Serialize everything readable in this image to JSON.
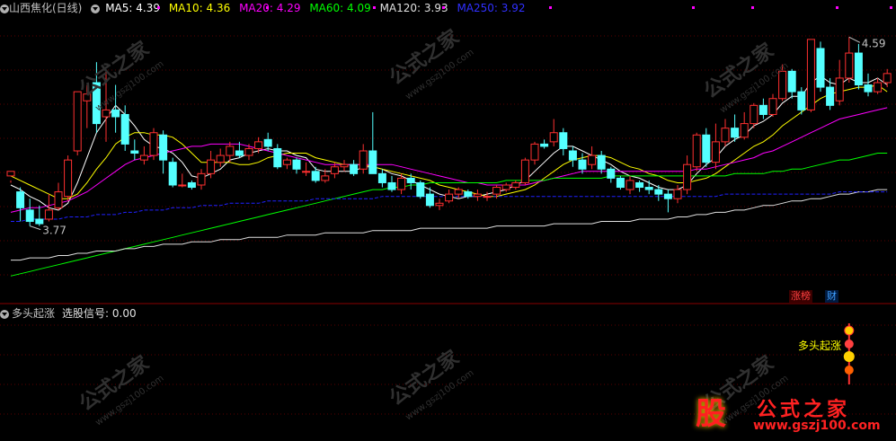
{
  "main_header": {
    "stock_name": "山西焦化(日线)",
    "ma5": "MA5: 4.39",
    "ma10": "MA10: 4.36",
    "ma20": "MA20: 4.29",
    "ma60": "MA60: 4.09",
    "ma120": "MA120: 3.93",
    "ma250": "MA250: 3.92"
  },
  "colors": {
    "ma5": "#ffffff",
    "ma10": "#ffff00",
    "ma20": "#ff00ff",
    "ma60": "#00ff00",
    "ma120": "#e0e0e0",
    "ma250": "#2020ff",
    "up": "#ff3030",
    "down": "#54ffff"
  },
  "price_labels": {
    "high": "4.59",
    "low": "3.77"
  },
  "tags": {
    "limit_up_list": "涨榜",
    "finance": "财"
  },
  "indicator_header": {
    "name": "多头起涨",
    "signal": "选股信号: 0.00"
  },
  "signal_label": "多头起涨",
  "logo": {
    "mark": "股",
    "brand": "公式之家",
    "url": "www.gszj100.com"
  },
  "watermark": {
    "brand": "公式之家",
    "url": "www.gszj100.com"
  },
  "chart_data": {
    "type": "candlestick",
    "candles": [
      [
        3.99,
        4.01,
        3.97,
        3.96
      ],
      [
        3.92,
        3.85,
        3.79,
        3.94
      ],
      [
        3.84,
        3.79,
        3.77,
        3.89
      ],
      [
        3.8,
        3.78,
        3.77,
        3.86
      ],
      [
        3.8,
        3.84,
        3.79,
        3.91
      ],
      [
        3.85,
        3.92,
        3.84,
        3.96
      ],
      [
        3.9,
        4.06,
        3.88,
        4.08
      ],
      [
        4.1,
        4.36,
        4.08,
        4.36
      ],
      [
        4.32,
        4.35,
        4.2,
        4.39
      ],
      [
        4.4,
        4.22,
        4.18,
        4.49
      ],
      [
        4.25,
        4.28,
        4.14,
        4.45
      ],
      [
        4.28,
        4.25,
        4.18,
        4.39
      ],
      [
        4.26,
        4.13,
        4.1,
        4.3
      ],
      [
        4.1,
        4.09,
        4.06,
        4.15
      ],
      [
        4.06,
        4.08,
        4.04,
        4.12
      ],
      [
        4.08,
        4.18,
        4.06,
        4.2
      ],
      [
        4.17,
        4.06,
        4.0,
        4.19
      ],
      [
        4.05,
        3.95,
        3.94,
        4.07
      ],
      [
        3.95,
        3.95,
        3.94,
        4.0
      ],
      [
        3.96,
        3.94,
        3.93,
        3.97
      ],
      [
        3.95,
        4.0,
        3.93,
        4.02
      ],
      [
        4.0,
        4.06,
        3.98,
        4.1
      ],
      [
        4.05,
        4.08,
        4.03,
        4.11
      ],
      [
        4.08,
        4.12,
        4.05,
        4.14
      ],
      [
        4.1,
        4.08,
        4.07,
        4.14
      ],
      [
        4.08,
        4.11,
        4.06,
        4.13
      ],
      [
        4.11,
        4.14,
        4.09,
        4.16
      ],
      [
        4.15,
        4.12,
        4.1,
        4.18
      ],
      [
        4.11,
        4.03,
        4.02,
        4.13
      ],
      [
        4.04,
        4.06,
        4.02,
        4.07
      ],
      [
        4.06,
        4.02,
        4.0,
        4.07
      ],
      [
        4.01,
        4.01,
        3.99,
        4.05
      ],
      [
        4.01,
        3.97,
        3.96,
        4.03
      ],
      [
        3.97,
        3.99,
        3.96,
        4.02
      ],
      [
        4.0,
        4.03,
        3.98,
        4.05
      ],
      [
        4.03,
        4.04,
        4.01,
        4.06
      ],
      [
        4.04,
        4.0,
        3.99,
        4.06
      ],
      [
        4.02,
        4.1,
        4.0,
        4.13
      ],
      [
        4.1,
        4.0,
        4.01,
        4.27
      ],
      [
        4.0,
        3.96,
        3.94,
        4.02
      ],
      [
        3.96,
        3.93,
        3.92,
        3.99
      ],
      [
        3.93,
        3.98,
        3.91,
        4.0
      ],
      [
        3.98,
        3.96,
        3.93,
        4.0
      ],
      [
        3.96,
        3.9,
        3.89,
        3.97
      ],
      [
        3.91,
        3.86,
        3.85,
        3.94
      ],
      [
        3.86,
        3.87,
        3.84,
        3.89
      ],
      [
        3.88,
        3.91,
        3.87,
        3.93
      ],
      [
        3.91,
        3.93,
        3.89,
        3.94
      ],
      [
        3.92,
        3.9,
        3.89,
        3.93
      ],
      [
        3.9,
        3.91,
        3.88,
        3.93
      ],
      [
        3.9,
        3.9,
        3.88,
        3.92
      ],
      [
        3.91,
        3.94,
        3.89,
        3.95
      ],
      [
        3.93,
        3.95,
        3.92,
        3.96
      ],
      [
        3.94,
        3.96,
        3.93,
        3.97
      ],
      [
        3.96,
        4.06,
        3.95,
        4.07
      ],
      [
        4.06,
        4.13,
        4.04,
        4.14
      ],
      [
        4.13,
        4.12,
        4.11,
        4.15
      ],
      [
        4.14,
        4.18,
        4.12,
        4.24
      ],
      [
        4.18,
        4.11,
        4.08,
        4.2
      ],
      [
        4.1,
        4.06,
        4.03,
        4.12
      ],
      [
        4.06,
        4.02,
        4.0,
        4.09
      ],
      [
        4.04,
        4.08,
        4.02,
        4.12
      ],
      [
        4.08,
        4.02,
        4.0,
        4.1
      ],
      [
        4.02,
        3.98,
        3.96,
        4.03
      ],
      [
        3.98,
        3.94,
        3.93,
        3.99
      ],
      [
        3.93,
        3.97,
        3.91,
        3.99
      ],
      [
        3.96,
        3.94,
        3.92,
        3.97
      ],
      [
        3.94,
        3.93,
        3.91,
        3.97
      ],
      [
        3.93,
        3.91,
        3.88,
        3.95
      ],
      [
        3.91,
        3.89,
        3.83,
        3.93
      ],
      [
        3.89,
        3.93,
        3.87,
        3.95
      ],
      [
        3.93,
        4.04,
        3.91,
        4.08
      ],
      [
        4.03,
        4.17,
        4.01,
        4.18
      ],
      [
        4.17,
        4.05,
        4.03,
        4.2
      ],
      [
        4.05,
        4.14,
        4.02,
        4.22
      ],
      [
        4.14,
        4.2,
        4.12,
        4.24
      ],
      [
        4.2,
        4.16,
        4.14,
        4.26
      ],
      [
        4.16,
        4.22,
        4.15,
        4.27
      ],
      [
        4.22,
        4.3,
        4.2,
        4.31
      ],
      [
        4.3,
        4.26,
        4.24,
        4.33
      ],
      [
        4.26,
        4.33,
        4.25,
        4.35
      ],
      [
        4.33,
        4.45,
        4.32,
        4.48
      ],
      [
        4.45,
        4.36,
        4.33,
        4.46
      ],
      [
        4.36,
        4.28,
        4.26,
        4.38
      ],
      [
        4.28,
        4.59,
        4.27,
        4.59
      ],
      [
        4.55,
        4.38,
        4.36,
        4.58
      ],
      [
        4.38,
        4.3,
        4.28,
        4.42
      ],
      [
        4.32,
        4.42,
        4.3,
        4.5
      ],
      [
        4.42,
        4.53,
        4.4,
        4.6
      ],
      [
        4.53,
        4.39,
        4.37,
        4.57
      ],
      [
        4.39,
        4.36,
        4.34,
        4.44
      ],
      [
        4.36,
        4.4,
        4.35,
        4.42
      ],
      [
        4.4,
        4.44,
        4.38,
        4.46
      ]
    ],
    "ma_series": [
      {
        "name": "MA5",
        "values": [
          3.95,
          3.93,
          3.9,
          3.88,
          3.85,
          3.84,
          3.87,
          3.96,
          4.07,
          4.18,
          4.24,
          4.3,
          4.26,
          4.21,
          4.15,
          4.12,
          4.11,
          4.09,
          4.05,
          3.99,
          3.98,
          4.0,
          4.02,
          4.06,
          4.07,
          4.09,
          4.1,
          4.11,
          4.1,
          4.1,
          4.08,
          4.07,
          4.02,
          4.01,
          4.01,
          4.01,
          4.01,
          4.03,
          4.03,
          4.02,
          4.0,
          3.99,
          3.97,
          3.95,
          3.93,
          3.91,
          3.9,
          3.89,
          3.9,
          3.9,
          3.91,
          3.92,
          3.93,
          3.95,
          3.97,
          4.01,
          4.05,
          4.09,
          4.12,
          4.12,
          4.1,
          4.08,
          4.06,
          4.04,
          4.01,
          3.99,
          3.98,
          3.96,
          3.94,
          3.93,
          3.93,
          3.95,
          4.0,
          4.04,
          4.07,
          4.12,
          4.15,
          4.17,
          4.21,
          4.23,
          4.26,
          4.31,
          4.34,
          4.34,
          4.4,
          4.43,
          4.4,
          4.39,
          4.42,
          4.4,
          4.4,
          4.42,
          4.39
        ]
      },
      {
        "name": "MA10",
        "values": [
          3.99,
          3.97,
          3.95,
          3.93,
          3.91,
          3.89,
          3.89,
          3.91,
          3.96,
          4.02,
          4.07,
          4.13,
          4.16,
          4.18,
          4.18,
          4.17,
          4.17,
          4.16,
          4.13,
          4.09,
          4.05,
          4.05,
          4.05,
          4.05,
          4.04,
          4.04,
          4.05,
          4.07,
          4.08,
          4.09,
          4.09,
          4.09,
          4.07,
          4.06,
          4.05,
          4.04,
          4.04,
          4.04,
          4.03,
          4.02,
          4.01,
          4.0,
          3.99,
          3.98,
          3.97,
          3.95,
          3.94,
          3.93,
          3.92,
          3.91,
          3.9,
          3.9,
          3.91,
          3.92,
          3.93,
          3.95,
          3.98,
          4.01,
          4.04,
          4.06,
          4.07,
          4.08,
          4.08,
          4.07,
          4.05,
          4.03,
          4.02,
          4.0,
          3.99,
          3.97,
          3.96,
          3.96,
          3.97,
          3.98,
          4.0,
          4.03,
          4.06,
          4.09,
          4.12,
          4.14,
          4.17,
          4.21,
          4.24,
          4.27,
          4.3,
          4.33,
          4.35,
          4.36,
          4.37,
          4.38,
          4.38,
          4.39,
          4.36
        ]
      },
      {
        "name": "MA20",
        "values": [
          3.83,
          3.84,
          3.85,
          3.85,
          3.86,
          3.87,
          3.88,
          3.9,
          3.92,
          3.95,
          3.98,
          4.01,
          4.04,
          4.06,
          4.07,
          4.08,
          4.09,
          4.1,
          4.11,
          4.12,
          4.12,
          4.13,
          4.13,
          4.13,
          4.13,
          4.12,
          4.11,
          4.1,
          4.09,
          4.08,
          4.07,
          4.06,
          4.05,
          4.04,
          4.04,
          4.04,
          4.04,
          4.04,
          4.04,
          4.04,
          4.04,
          4.03,
          4.02,
          4.01,
          4.0,
          3.99,
          3.98,
          3.97,
          3.96,
          3.96,
          3.95,
          3.95,
          3.95,
          3.95,
          3.95,
          3.96,
          3.97,
          3.98,
          3.99,
          4.0,
          4.01,
          4.01,
          4.01,
          4.01,
          4.01,
          4.01,
          4.01,
          4.01,
          4.01,
          4.01,
          4.01,
          4.01,
          4.02,
          4.02,
          4.03,
          4.04,
          4.05,
          4.06,
          4.07,
          4.09,
          4.1,
          4.12,
          4.14,
          4.16,
          4.18,
          4.2,
          4.22,
          4.24,
          4.25,
          4.26,
          4.27,
          4.28,
          4.29
        ]
      },
      {
        "name": "MA60",
        "values": [
          3.55,
          3.56,
          3.57,
          3.58,
          3.59,
          3.6,
          3.61,
          3.62,
          3.63,
          3.64,
          3.65,
          3.66,
          3.67,
          3.68,
          3.69,
          3.7,
          3.71,
          3.72,
          3.73,
          3.74,
          3.75,
          3.76,
          3.77,
          3.78,
          3.79,
          3.8,
          3.81,
          3.82,
          3.83,
          3.84,
          3.85,
          3.86,
          3.87,
          3.88,
          3.89,
          3.9,
          3.91,
          3.92,
          3.93,
          3.93,
          3.94,
          3.94,
          3.95,
          3.95,
          3.96,
          3.96,
          3.96,
          3.96,
          3.96,
          3.96,
          3.96,
          3.96,
          3.97,
          3.97,
          3.97,
          3.97,
          3.97,
          3.98,
          3.98,
          3.98,
          3.98,
          3.98,
          3.98,
          3.99,
          3.99,
          3.99,
          3.99,
          3.99,
          3.99,
          3.99,
          3.99,
          3.99,
          3.99,
          3.99,
          3.99,
          3.99,
          4.0,
          4.0,
          4.0,
          4.0,
          4.01,
          4.01,
          4.02,
          4.02,
          4.03,
          4.04,
          4.05,
          4.06,
          4.06,
          4.07,
          4.08,
          4.09,
          4.09
        ]
      },
      {
        "name": "MA120",
        "values": [
          3.62,
          3.62,
          3.63,
          3.63,
          3.63,
          3.64,
          3.64,
          3.65,
          3.65,
          3.66,
          3.66,
          3.66,
          3.67,
          3.67,
          3.68,
          3.68,
          3.69,
          3.69,
          3.69,
          3.7,
          3.7,
          3.7,
          3.71,
          3.71,
          3.71,
          3.72,
          3.72,
          3.72,
          3.72,
          3.73,
          3.73,
          3.73,
          3.73,
          3.74,
          3.74,
          3.74,
          3.74,
          3.74,
          3.75,
          3.75,
          3.75,
          3.75,
          3.75,
          3.76,
          3.76,
          3.76,
          3.76,
          3.76,
          3.76,
          3.76,
          3.76,
          3.77,
          3.77,
          3.77,
          3.77,
          3.77,
          3.77,
          3.78,
          3.78,
          3.78,
          3.78,
          3.78,
          3.79,
          3.79,
          3.79,
          3.79,
          3.8,
          3.8,
          3.8,
          3.8,
          3.81,
          3.81,
          3.82,
          3.82,
          3.83,
          3.83,
          3.84,
          3.84,
          3.85,
          3.86,
          3.86,
          3.87,
          3.88,
          3.88,
          3.89,
          3.89,
          3.9,
          3.91,
          3.91,
          3.92,
          3.92,
          3.93,
          3.93
        ]
      },
      {
        "name": "MA250",
        "values": [
          3.79,
          3.79,
          3.8,
          3.8,
          3.8,
          3.8,
          3.81,
          3.81,
          3.81,
          3.82,
          3.82,
          3.82,
          3.83,
          3.83,
          3.84,
          3.84,
          3.84,
          3.85,
          3.85,
          3.85,
          3.86,
          3.86,
          3.86,
          3.87,
          3.87,
          3.87,
          3.87,
          3.88,
          3.88,
          3.88,
          3.88,
          3.88,
          3.89,
          3.89,
          3.89,
          3.89,
          3.89,
          3.89,
          3.89,
          3.9,
          3.9,
          3.9,
          3.9,
          3.9,
          3.9,
          3.9,
          3.9,
          3.9,
          3.9,
          3.9,
          3.9,
          3.9,
          3.9,
          3.9,
          3.9,
          3.9,
          3.9,
          3.9,
          3.9,
          3.9,
          3.9,
          3.9,
          3.9,
          3.9,
          3.9,
          3.9,
          3.9,
          3.9,
          3.9,
          3.9,
          3.9,
          3.9,
          3.9,
          3.9,
          3.9,
          3.91,
          3.91,
          3.91,
          3.91,
          3.91,
          3.91,
          3.91,
          3.91,
          3.91,
          3.91,
          3.91,
          3.91,
          3.92,
          3.92,
          3.92,
          3.92,
          3.92,
          3.92
        ]
      }
    ]
  }
}
